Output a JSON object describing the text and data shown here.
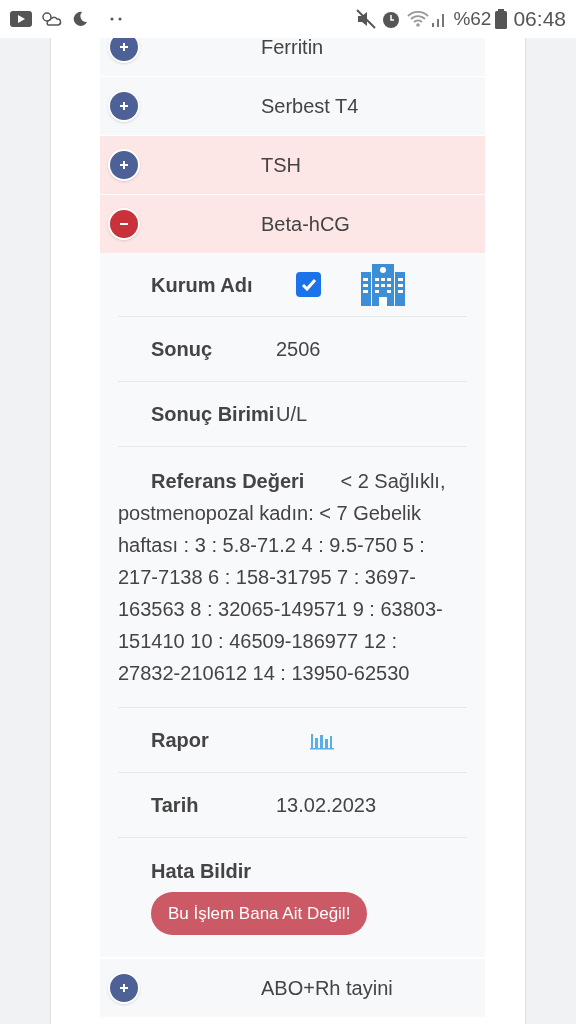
{
  "status_bar": {
    "battery": "%62",
    "time": "06:48"
  },
  "tests": [
    {
      "name": "Ferritin",
      "expanded": false,
      "highlighted": false
    },
    {
      "name": "Serbest T4",
      "expanded": false,
      "highlighted": false
    },
    {
      "name": "TSH",
      "expanded": false,
      "highlighted": true
    },
    {
      "name": "Beta-hCG",
      "expanded": true,
      "highlighted": true,
      "details": [
        {
          "kind": "checkbox",
          "label": "Kurum Adı",
          "checked": true
        },
        {
          "kind": "text",
          "label": "Sonuç",
          "value": "2506"
        },
        {
          "kind": "text",
          "label": "Sonuç Birimi",
          "value": "U/L"
        },
        {
          "kind": "paragraph",
          "label": "Referans Değeri",
          "value": "< 2 Sağlıklı, postmenopozal kadın: < 7 Gebelik haftası : 3 : 5.8-71.2 4 : 9.5-750 5 : 217-7138 6 : 158-31795 7 : 3697-163563 8 : 32065-149571 9 : 63803-151410 10 : 46509-186977 12 : 27832-210612 14 : 13950-62530"
        },
        {
          "kind": "chart",
          "label": "Rapor"
        },
        {
          "kind": "text",
          "label": "Tarih",
          "value": "13.02.2023"
        },
        {
          "kind": "button",
          "label": "Hata Bildir",
          "button": "Bu İşlem Bana Ait Değil!"
        }
      ]
    },
    {
      "name": "ABO+Rh tayini",
      "expanded": false,
      "highlighted": false
    }
  ]
}
